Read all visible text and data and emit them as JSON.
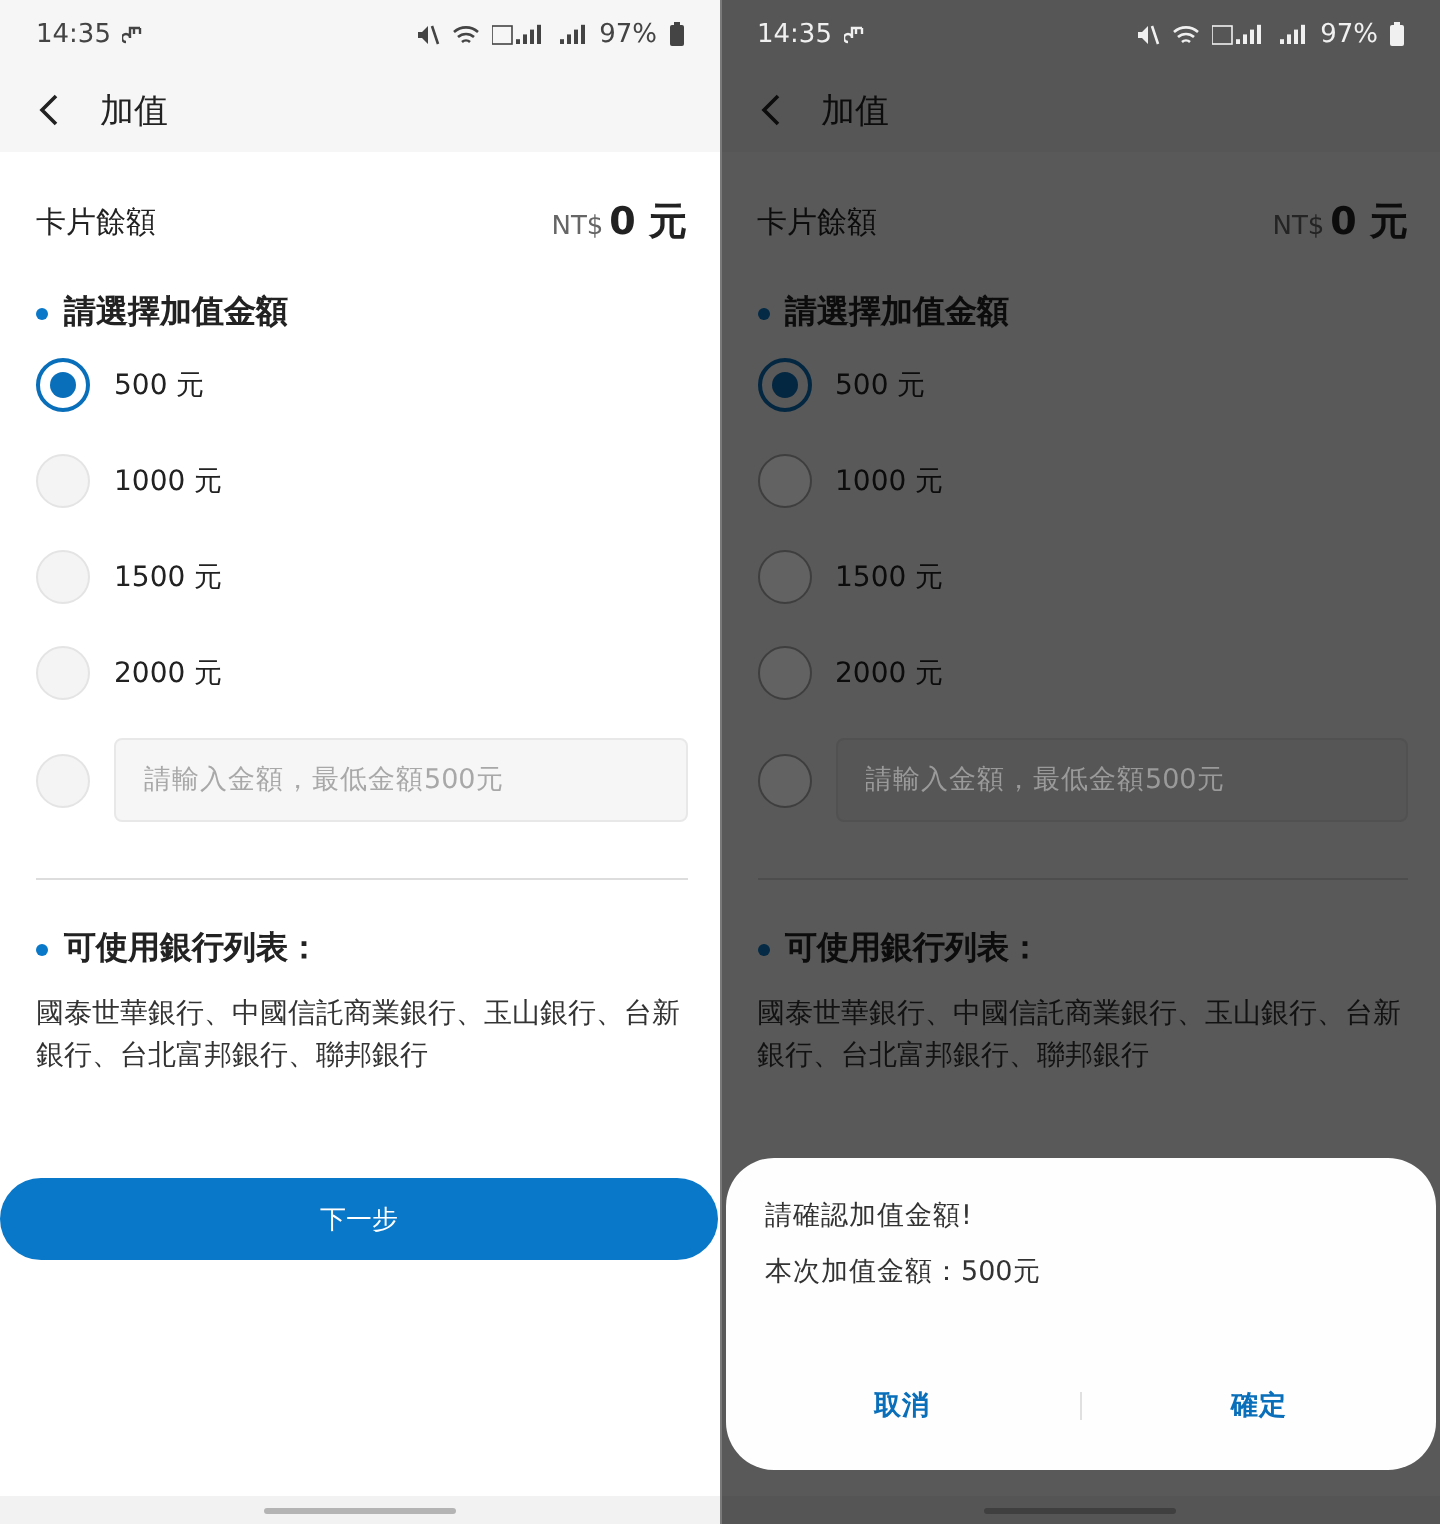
{
  "screens": [
    {
      "dimmed": false,
      "status_bar": {
        "time": "14:35",
        "battery": "97%"
      },
      "header": {
        "title": "加值"
      },
      "balance": {
        "label": "卡片餘額",
        "currency": "NT$",
        "amount": "0 元"
      },
      "amount_section": {
        "title": "請選擇加值金額",
        "options": [
          {
            "label": "500 元",
            "selected": true
          },
          {
            "label": "1000 元",
            "selected": false
          },
          {
            "label": "1500 元",
            "selected": false
          },
          {
            "label": "2000 元",
            "selected": false
          }
        ],
        "custom": {
          "placeholder": "請輸入金額，最低金額500元",
          "selected": false
        }
      },
      "bank_section": {
        "title": "可使用銀行列表：",
        "text": "國泰世華銀行、中國信託商業銀行、玉山銀行、台新銀行、台北富邦銀行、聯邦銀行"
      },
      "next_button": "下一步"
    },
    {
      "dimmed": true,
      "status_bar": {
        "time": "14:35",
        "battery": "97%"
      },
      "header": {
        "title": "加值"
      },
      "balance": {
        "label": "卡片餘額",
        "currency": "NT$",
        "amount": "0 元"
      },
      "amount_section": {
        "title": "請選擇加值金額",
        "options": [
          {
            "label": "500 元",
            "selected": true
          },
          {
            "label": "1000 元",
            "selected": false
          },
          {
            "label": "1500 元",
            "selected": false
          },
          {
            "label": "2000 元",
            "selected": false
          }
        ],
        "custom": {
          "placeholder": "請輸入金額，最低金額500元",
          "selected": false
        }
      },
      "bank_section": {
        "title": "可使用銀行列表：",
        "text": "國泰世華銀行、中國信託商業銀行、玉山銀行、台新銀行、台北富邦銀行、聯邦銀行"
      },
      "dialog": {
        "title": "請確認加值金額!",
        "message": "本次加值金額：500元",
        "buttons": [
          "取消",
          "確定"
        ]
      }
    }
  ]
}
